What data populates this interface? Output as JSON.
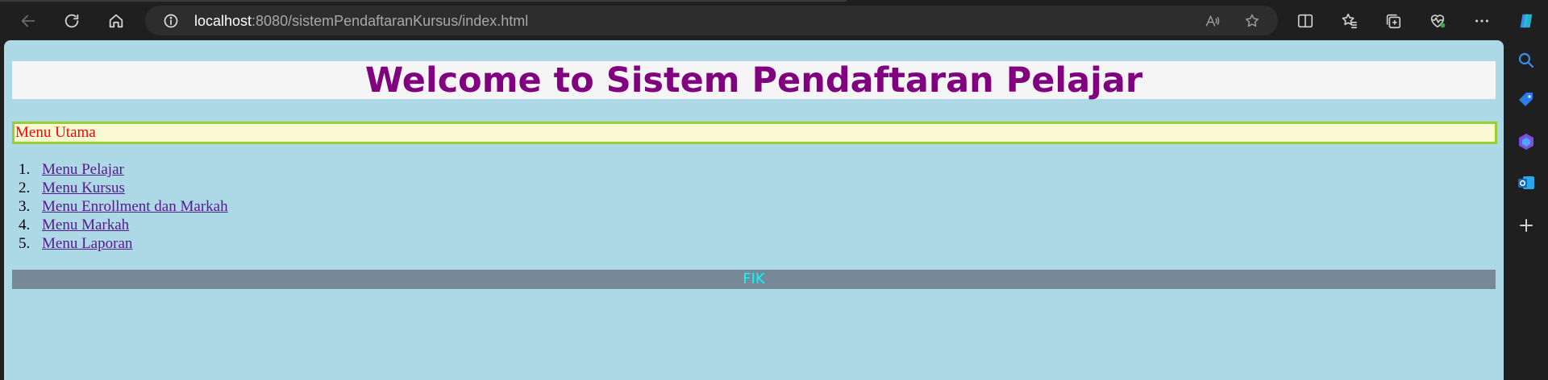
{
  "browser": {
    "address": {
      "host": "localhost",
      "path": ":8080/sistemPendaftaranKursus/index.html"
    },
    "icons": {
      "back": "arrow-left-icon",
      "refresh": "refresh-icon",
      "home": "home-icon",
      "site_info": "info-icon",
      "read_aloud": "read-aloud-icon",
      "favorite": "star-icon",
      "split_screen": "split-screen-icon",
      "favorites": "favorites-list-icon",
      "collections": "collections-icon",
      "browser_essentials": "heart-pulse-icon",
      "more": "more-icon",
      "copilot": "copilot-icon"
    }
  },
  "sidebar": {
    "items": [
      "search-icon",
      "shopping-tag-icon",
      "games-icon",
      "outlook-icon",
      "add-icon"
    ]
  },
  "page": {
    "title": "Welcome to Sistem Pendaftaran Pelajar",
    "menu_caption": "Menu Utama",
    "menu_items": [
      {
        "num": "1.",
        "label": "Menu Pelajar"
      },
      {
        "num": "2.",
        "label": "Menu Kursus"
      },
      {
        "num": "3.",
        "label": "Menu Enrollment dan Markah"
      },
      {
        "num": "4.",
        "label": "Menu Markah"
      },
      {
        "num": "5.",
        "label": "Menu Laporan"
      }
    ],
    "footer": "FIK"
  },
  "colors": {
    "page_background": "#add8e6",
    "title": "#800080",
    "caption_background": "#fafad2",
    "caption_border": "#9acd32",
    "caption_text": "#ff0000",
    "footer_background": "#778899",
    "footer_text": "#00ffff",
    "link": "#551a8b"
  }
}
